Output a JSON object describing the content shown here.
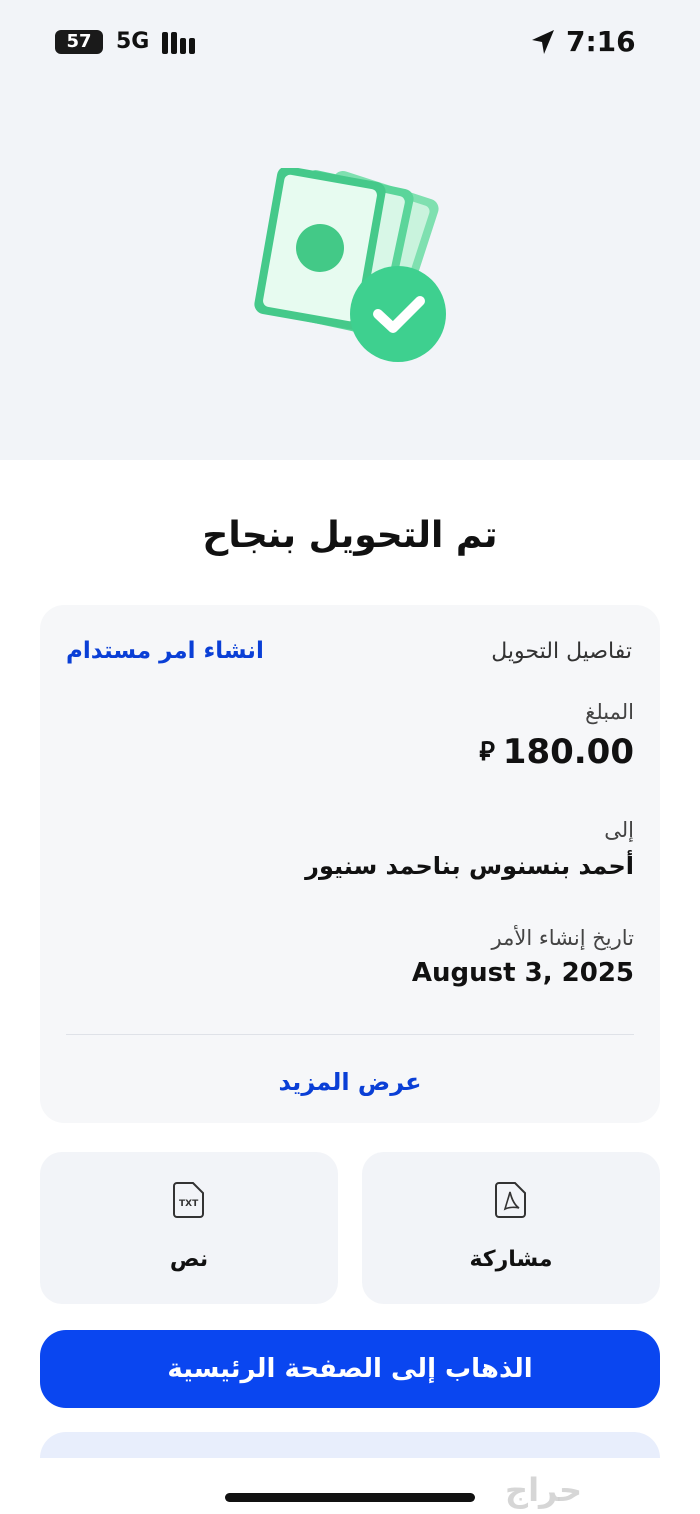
{
  "status_bar": {
    "battery": "57",
    "network": "5G",
    "time": "7:16"
  },
  "title": "تم التحويل بنجاح",
  "details": {
    "header": "تفاصيل التحويل",
    "create_standing_order": "انشاء امر مستدام",
    "amount_label": "المبلغ",
    "amount_value": "180.00",
    "currency_symbol": "⃁",
    "to_label": "إلى",
    "to_value": "أحمد بنسنوس بناحمد سنيور",
    "date_label": "تاريخ إنشاء الأمر",
    "date_value": "August 3, 2025",
    "show_more": "عرض المزيد"
  },
  "actions": {
    "text_label": "نص",
    "text_icon": "txt-file-icon",
    "share_label": "مشاركة",
    "share_icon": "pdf-file-icon"
  },
  "home_button": "الذهاب إلى الصفحة الرئيسية",
  "watermark": "حراج",
  "colors": {
    "accent_blue": "#0a46f0",
    "link_blue": "#0a3fd6",
    "success_green": "#3ed08f",
    "hero_bg": "#f2f4f8"
  }
}
